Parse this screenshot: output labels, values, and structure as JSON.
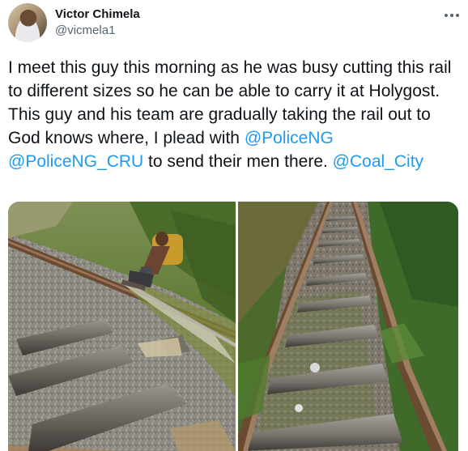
{
  "author": {
    "display_name": "Victor Chimela",
    "handle": "@vicmela1",
    "avatar_icon": "profile-photo"
  },
  "menu_icon": "more-horizontal-icon",
  "tweet": {
    "text_intro": "I meet this guy this morning as he was busy cutting this rail to different sizes so he can be able to carry it at Holygost. This guy and his team are gradually taking the rail out to God knows where, I plead with ",
    "mention_1": "@PoliceNG",
    "mention_2": "@PoliceNG_CRU",
    "text_outro": " to send their men there. ",
    "mention_3": "@Coal_City"
  },
  "media": {
    "photo_count": 2
  },
  "colors": {
    "link": "#1d9bf0",
    "text": "#0f1419",
    "secondary": "#536471"
  }
}
